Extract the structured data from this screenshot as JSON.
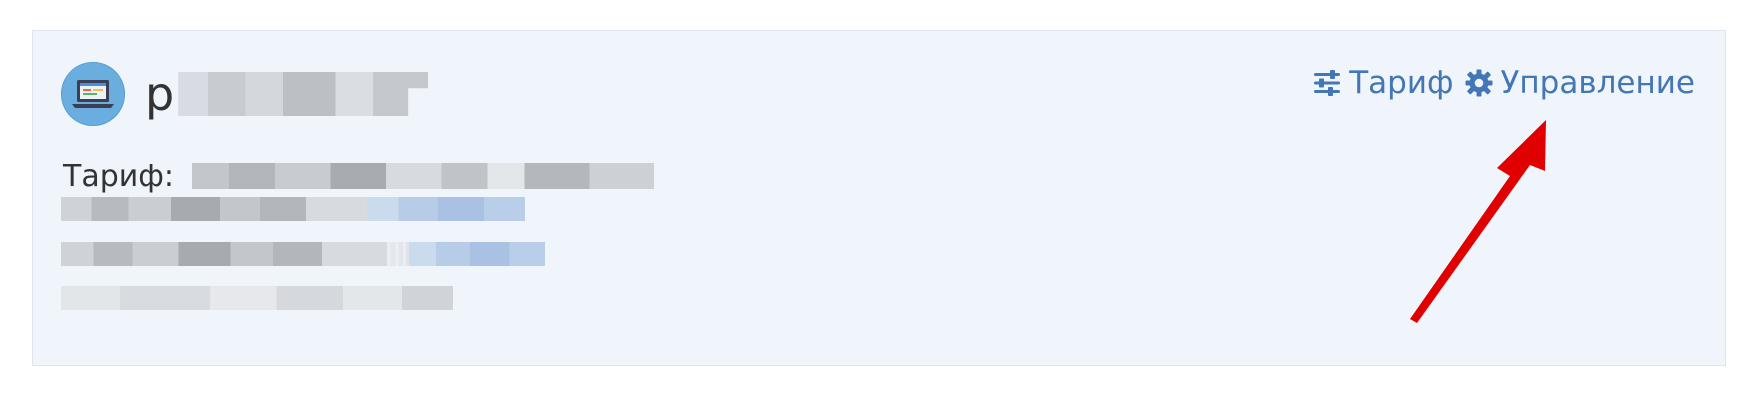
{
  "server_card": {
    "name_prefix": "р",
    "tariff_label": "Тариф:",
    "actions": {
      "tariff_label": "Тариф",
      "manage_label": "Управление"
    }
  },
  "icons": {
    "server": "laptop-icon",
    "tariff": "sliders-icon",
    "manage": "gear-icon"
  },
  "colors": {
    "card_background": "#f0f5fc",
    "link": "#4376b4",
    "arrow": "#e00000"
  }
}
